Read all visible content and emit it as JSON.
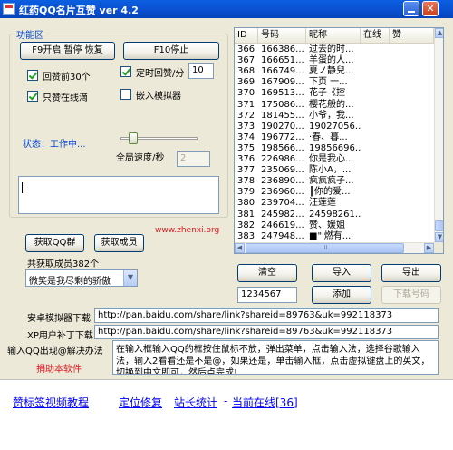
{
  "window": {
    "title": "红药QQ名片互赞 ver 4.2"
  },
  "group": {
    "title": "功能区"
  },
  "buttons": {
    "f9": "F9开启 暂停 恢复",
    "f10": "F10停止",
    "get_groups": "获取QQ群",
    "get_members": "获取成员",
    "clear": "清空",
    "import": "导入",
    "export": "导出",
    "add": "添加",
    "download": "下载号码"
  },
  "checks": {
    "praise_top30": {
      "label": "回赞前30个",
      "checked": true
    },
    "timed_praise": {
      "label": "定时回赞/分",
      "checked": true
    },
    "online_only": {
      "label": "只赞在线滴",
      "checked": true
    },
    "embed_emulator": {
      "label": "嵌入模拟器",
      "checked": false
    }
  },
  "timed_minutes": "10",
  "status": "状态：工作中...",
  "speed_label": "全局速度/秒",
  "speed_value": "2",
  "watermark": "www.zhenxi.org",
  "members_count": "共获取成员382个",
  "group_select": "微笑是我尽剩的骄傲",
  "add_input": "1234567",
  "table": {
    "headers": [
      "ID",
      "号码",
      "昵称",
      "在线",
      "赞"
    ],
    "rows": [
      [
        "366",
        "166386...",
        "过去的时...",
        "",
        ""
      ],
      [
        "367",
        "166651...",
        "羊蛋的人...",
        "",
        ""
      ],
      [
        "368",
        "166749...",
        "夏ノ静兒...",
        "",
        ""
      ],
      [
        "369",
        "167909...",
        "下页  一...",
        "",
        ""
      ],
      [
        "370",
        "169513...",
        "花子《控",
        "",
        ""
      ],
      [
        "371",
        "175086...",
        "樱花般的...",
        "",
        ""
      ],
      [
        "372",
        "181455...",
        "小爷，我...",
        "",
        ""
      ],
      [
        "373",
        "190270...",
        "19027056...",
        "",
        ""
      ],
      [
        "374",
        "196772...",
        "·春、暮...",
        "",
        ""
      ],
      [
        "375",
        "198566...",
        "19856696...",
        "",
        ""
      ],
      [
        "376",
        "226986...",
        "你是我心...",
        "",
        ""
      ],
      [
        "377",
        "235069...",
        "陈小A，...",
        "",
        ""
      ],
      [
        "378",
        "236890...",
        "疯疯疯子...",
        "",
        ""
      ],
      [
        "379",
        "236960...",
        "╂你的爱...",
        "",
        ""
      ],
      [
        "380",
        "239704...",
        "汪莲莲",
        "",
        ""
      ],
      [
        "381",
        "245982...",
        "24598261...",
        "",
        ""
      ],
      [
        "382",
        "246619...",
        "赞、媛姐",
        "",
        ""
      ],
      [
        "383",
        "247948...",
        "■\"'燃有...",
        "",
        ""
      ]
    ]
  },
  "links": {
    "android_label": "安卓模拟器下载",
    "android_url": "http://pan.baidu.com/share/link?shareid=89763&uk=992118373",
    "xp_label": "XP用户补丁下载",
    "xp_url": "http://pan.baidu.com/share/link?shareid=89763&uk=992118373",
    "input_label": "输入QQ出现@解决办法",
    "input_text": "在输入框输入QQ的框按住鼠标不放，弹出菜单，点击输入法，选择谷歌输入法，输入2看看还是不是@，如果还是，单击输入框，点击虚拟键盘上的英文，切换到中文即可，然后点完成!",
    "donate": "捐助本软件"
  },
  "bottom_links": [
    "赞标签视频教程",
    "定位修复",
    "站长统计",
    "-",
    "当前在线[36]"
  ],
  "colors": {
    "accent": "#0046d5",
    "red": "#e0141e",
    "link": "#0000ff"
  }
}
